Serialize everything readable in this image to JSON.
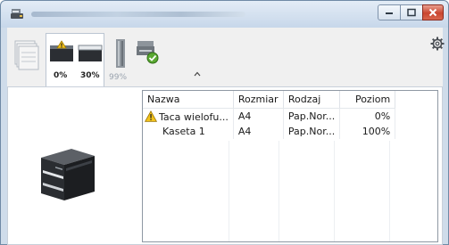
{
  "toolbar": {
    "trays": [
      {
        "id": "tray-bypass",
        "level": "0%"
      },
      {
        "id": "tray-cassette",
        "level": "30%"
      }
    ],
    "toner_level": "99%"
  },
  "table": {
    "headers": [
      "Nazwa",
      "Rozmiar",
      "Rodzaj",
      "Poziom"
    ],
    "rows": [
      {
        "name": "Taca wielofu...",
        "size": "A4",
        "type": "Pap.Nor...",
        "level": "0%",
        "warning": true
      },
      {
        "name": "Kaseta 1",
        "size": "A4",
        "type": "Pap.Nor...",
        "level": "100%",
        "warning": false
      }
    ]
  },
  "colors": {
    "window_frame": "#cfdcea",
    "close_button": "#c9452f",
    "warning": "#f2c21b"
  }
}
